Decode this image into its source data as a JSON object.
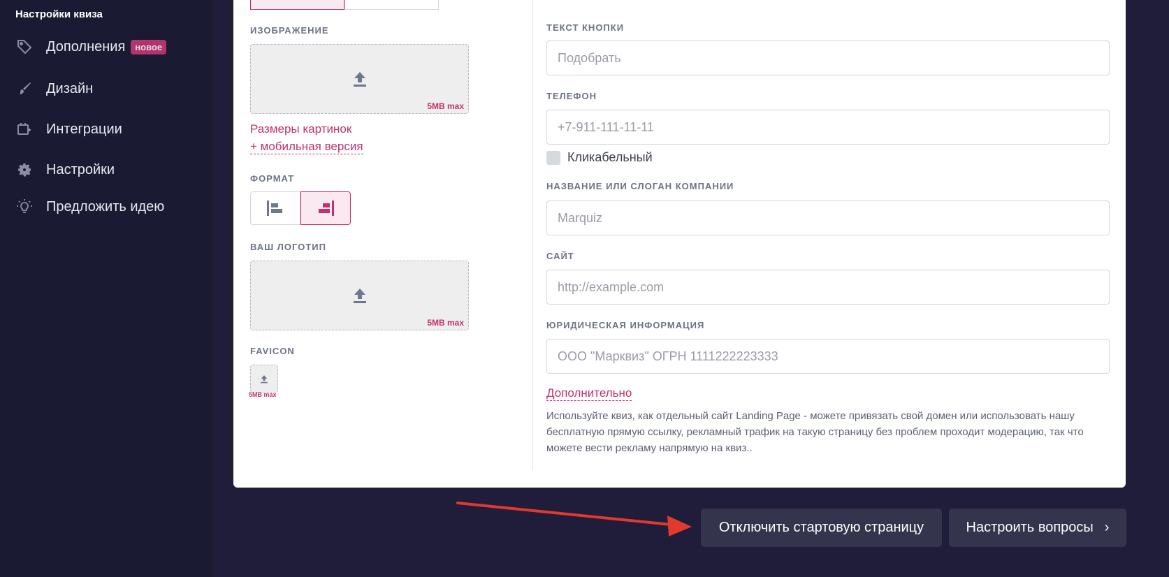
{
  "sidebar": {
    "title": "Настройки квиза",
    "items": [
      {
        "label": "Дополнения",
        "badge": "новое",
        "icon": "tag-icon"
      },
      {
        "label": "Дизайн",
        "icon": "brush-icon"
      },
      {
        "label": "Интеграции",
        "icon": "integration-icon"
      },
      {
        "label": "Настройки",
        "icon": "gear-icon"
      },
      {
        "label": "Предложить идею",
        "icon": "lightbulb-icon"
      }
    ]
  },
  "left_panel": {
    "image_label": "ИЗОБРАЖЕНИЕ",
    "upload_max": "5MB max",
    "sizes_link": "Размеры картинок",
    "mobile_link": "+ мобильная версия",
    "format_label": "ФОРМАТ",
    "logo_label": "ВАШ ЛОГОТИП",
    "favicon_label": "FAVICON"
  },
  "right_panel": {
    "button_text_label": "ТЕКСТ КНОПКИ",
    "button_text_placeholder": "Подобрать",
    "phone_label": "ТЕЛЕФОН",
    "phone_placeholder": "+7-911-111-11-11",
    "clickable_label": "Кликабельный",
    "company_label": "НАЗВАНИЕ ИЛИ СЛОГАН КОМПАНИИ",
    "company_placeholder": "Marquiz",
    "site_label": "САЙТ",
    "site_placeholder": "http://example.com",
    "legal_label": "ЮРИДИЧЕСКАЯ ИНФОРМАЦИЯ",
    "legal_placeholder": "ООО \"Марквиз\" ОГРН 1111222223333",
    "extra_link": "Дополнительно",
    "description": "Используйте квиз, как отдельный сайт Landing Page - можете привязать свой домен или использовать нашу бесплатную прямую ссылку, рекламный трафик на такую страницу без проблем проходит модерацию, так что можете вести рекламу напрямую на квиз.."
  },
  "footer": {
    "disable_button": "Отключить стартовую страницу",
    "setup_button": "Настроить вопросы"
  },
  "colors": {
    "accent": "#c2316d",
    "sidebar_bg": "#1b1a33",
    "page_bg": "#1f1d3a",
    "button_bg": "#34344c",
    "arrow": "#e0392e"
  }
}
